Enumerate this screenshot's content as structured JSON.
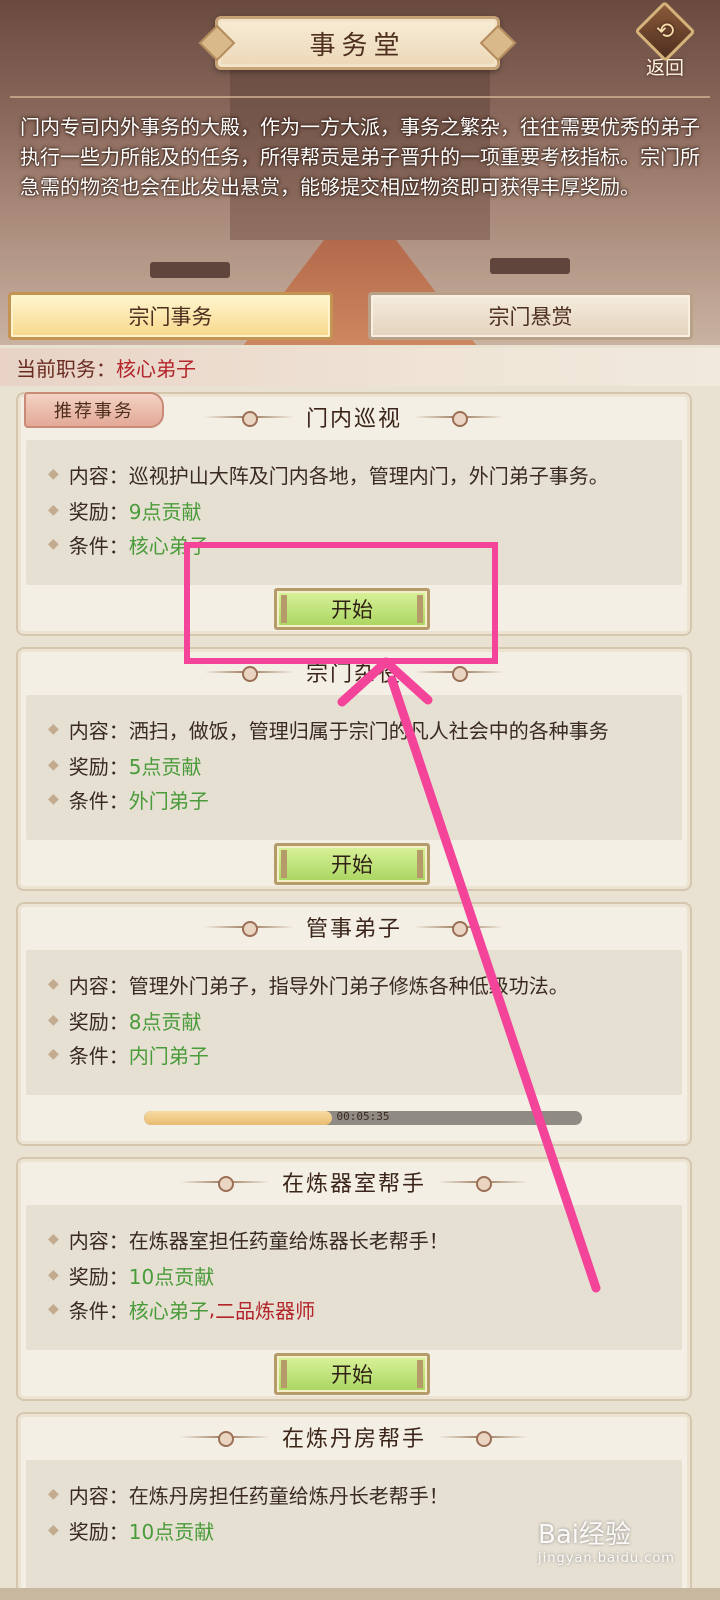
{
  "header": {
    "title": "事务堂",
    "back_label": "返回",
    "description": "门内专司内外事务的大殿，作为一方大派，事务之繁杂，往往需要优秀的弟子执行一些力所能及的任务，所得帮贡是弟子晋升的一项重要考核指标。宗门所急需的物资也会在此发出悬赏，能够提交相应物资即可获得丰厚奖励。"
  },
  "tabs": [
    {
      "label": "宗门事务",
      "active": true
    },
    {
      "label": "宗门悬赏",
      "active": false
    }
  ],
  "rank": {
    "label": "当前职务：",
    "value": "核心弟子"
  },
  "recommend_tag": "推荐事务",
  "labels": {
    "content": "内容：",
    "reward": "奖励：",
    "condition": "条件："
  },
  "tasks": [
    {
      "title": "门内巡视",
      "content": "巡视护山大阵及门内各地，管理内门，外门弟子事务。",
      "reward": "9点贡献",
      "condition": "核心弟子",
      "button": "开始"
    },
    {
      "title": "宗门杂役",
      "content": "洒扫，做饭，管理归属于宗门的凡人社会中的各种事务",
      "reward": "5点贡献",
      "condition": "外门弟子",
      "button": "开始"
    },
    {
      "title": "管事弟子",
      "content": "管理外门弟子，指导外门弟子修炼各种低级功法。",
      "reward": "8点贡献",
      "condition": "内门弟子",
      "timer": "00:05:35",
      "progress": 0.43
    },
    {
      "title": "在炼器室帮手",
      "content": "在炼器室担任药童给炼器长老帮手！",
      "reward": "10点贡献",
      "condition": "核心弟子",
      "condition_sep": ",",
      "condition_extra": "二品炼器师",
      "button": "开始"
    },
    {
      "title": "在炼丹房帮手",
      "content": "在炼丹房担任药童给炼丹长老帮手！",
      "reward": "10点贡献"
    }
  ],
  "watermark": {
    "brand": "Bai经验",
    "url": "jingyan.baidu.com"
  },
  "colors": {
    "highlight": "#f3449a",
    "reward_green": "#4a9b3a",
    "condition_red": "#b3252a",
    "button_green": "#b4dc6e"
  }
}
